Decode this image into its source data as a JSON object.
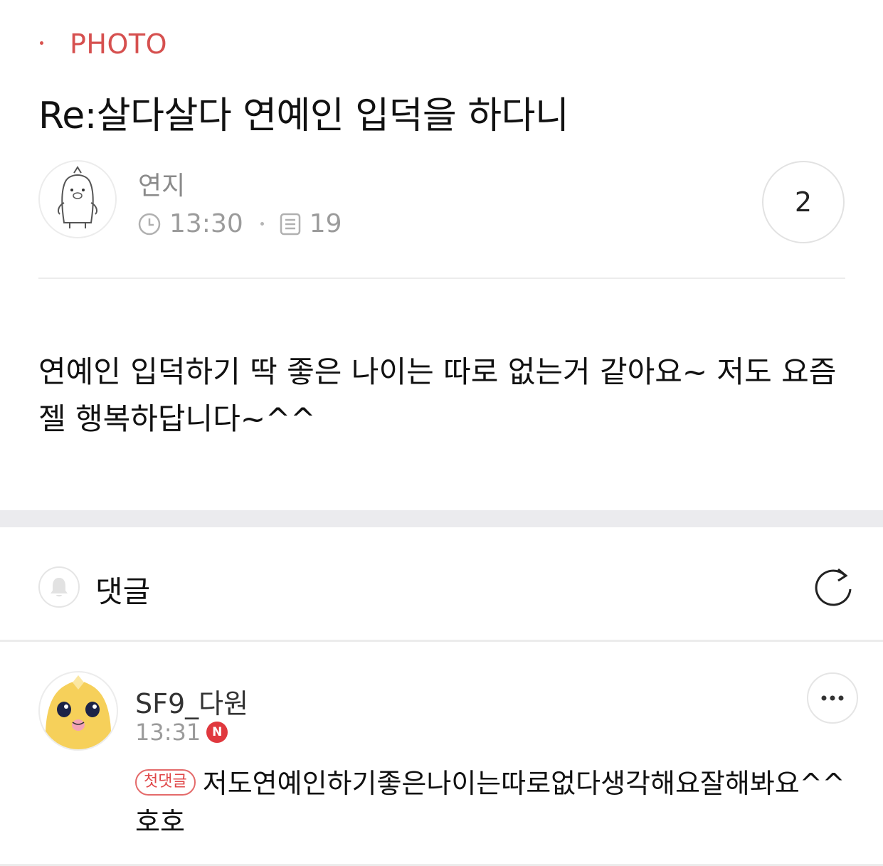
{
  "post": {
    "category": "PHOTO",
    "title": "Re:살다살다 연예인 입덕을 하다니",
    "author": "연지",
    "time": "13:30",
    "views": "19",
    "comment_count": "2",
    "body": "연예인 입덕하기 딱 좋은 나이는 따로 없는거 같아요~ 저도 요즘 젤 행복하답니다~^^"
  },
  "comments_section": {
    "header": "댓글",
    "items": [
      {
        "author": "SF9_다원",
        "time": "13:31",
        "new_badge": "N",
        "first_badge": "첫댓글",
        "text": "저도연예인하기좋은나이는따로없다생각해요잘해봐요^^호호"
      }
    ]
  },
  "colors": {
    "accent": "#d6504f",
    "meta_gray": "#9b9b9b",
    "divider": "#ececec",
    "band": "#ebebee"
  },
  "icons": {
    "author_avatar": "penguin-avatar-icon",
    "time": "clock-icon",
    "views": "document-icon",
    "notify": "bell-icon",
    "reload": "refresh-icon",
    "commenter_avatar": "yellow-character-avatar-icon",
    "more": "more-dots-icon"
  }
}
